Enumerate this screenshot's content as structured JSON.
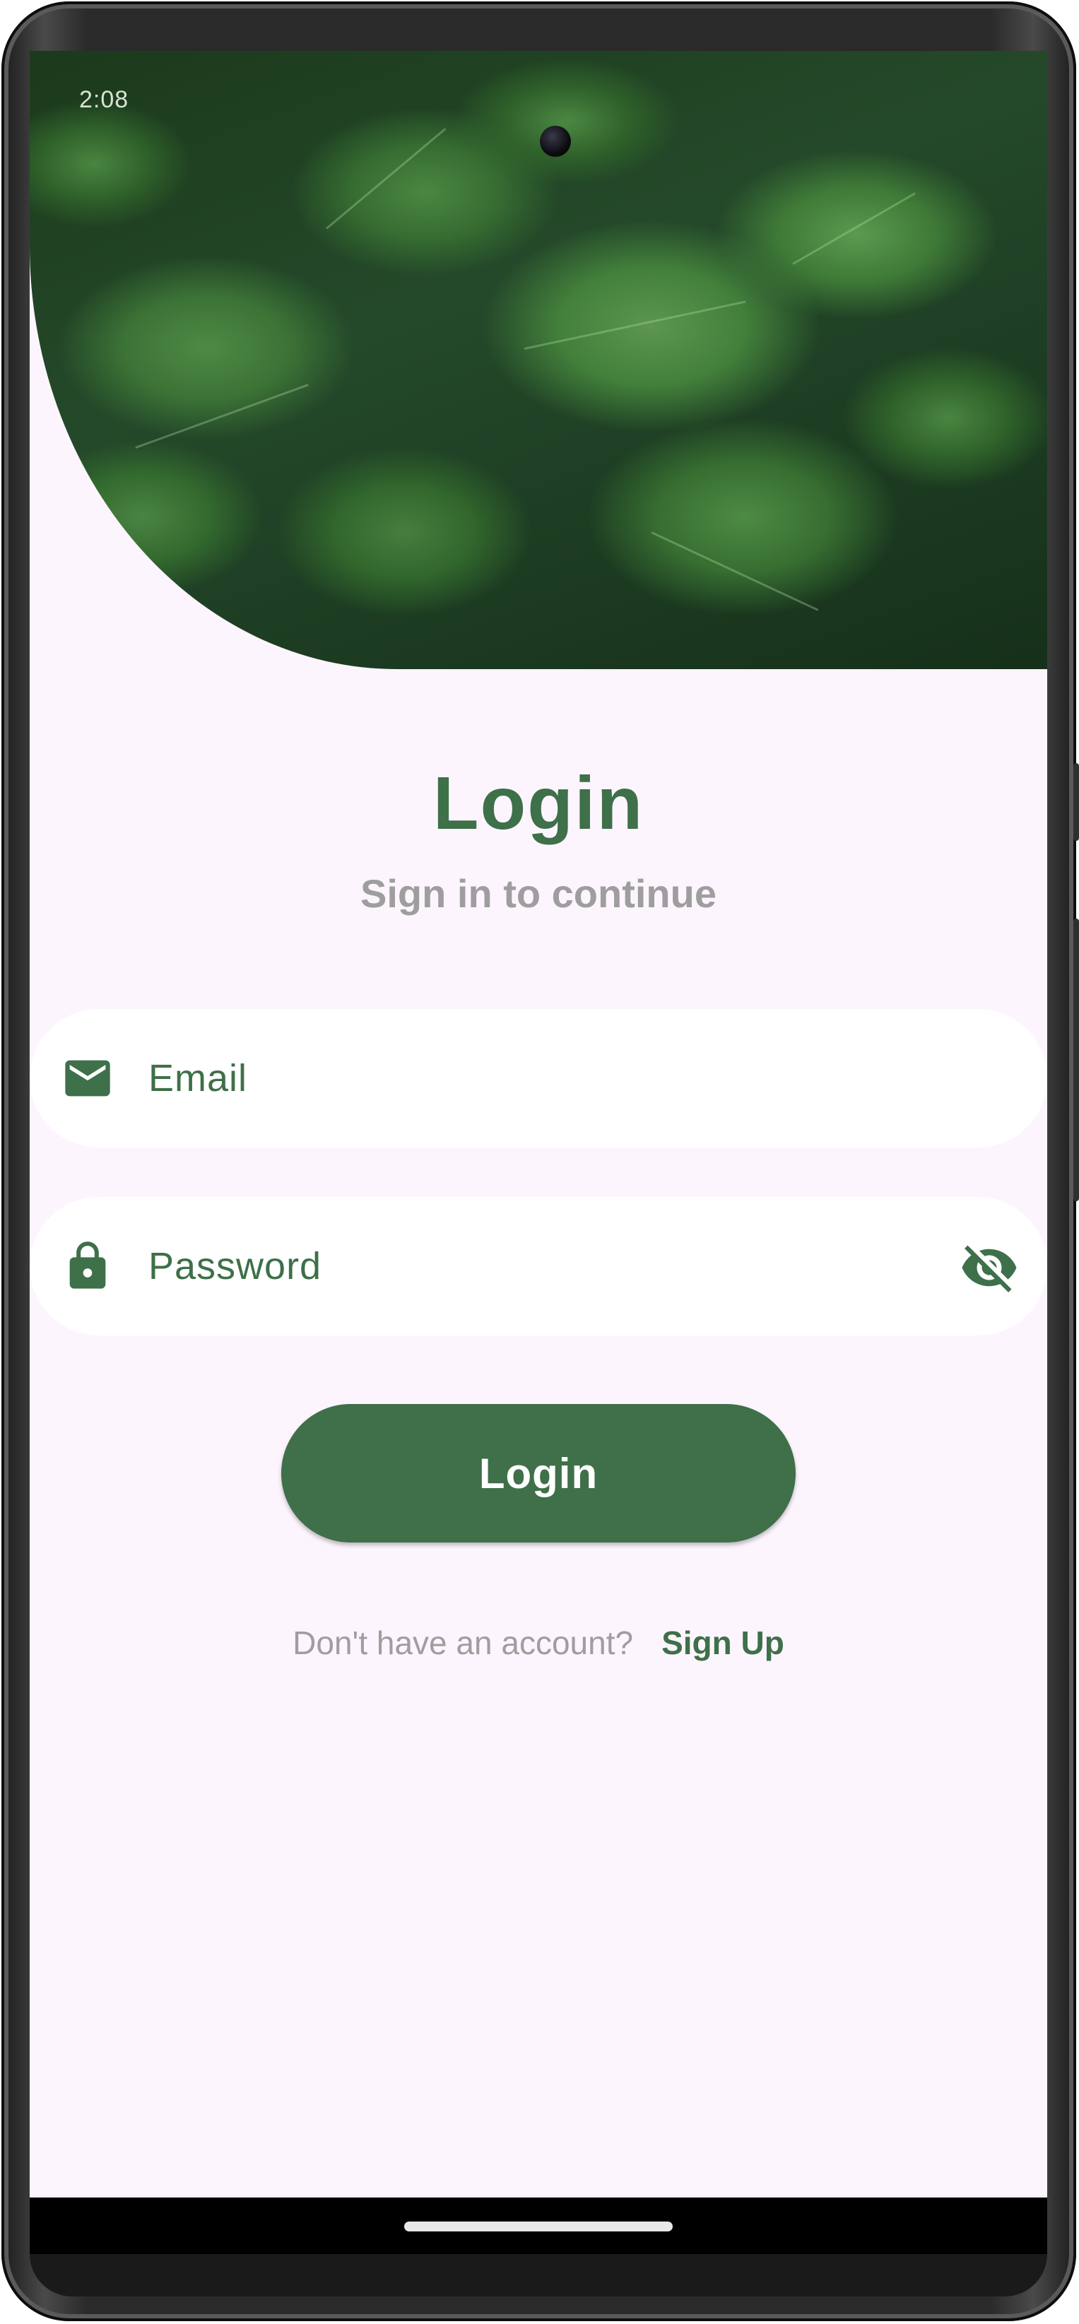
{
  "status_bar": {
    "time": "2:08"
  },
  "header": {
    "image_icon": "leaves-photo"
  },
  "login": {
    "title": "Login",
    "subtitle": "Sign in to continue"
  },
  "form": {
    "email": {
      "label": "Email",
      "icon": "mail-icon"
    },
    "password": {
      "label": "Password",
      "icon": "lock-icon",
      "toggle_icon": "eye-off-icon"
    }
  },
  "actions": {
    "login_button": "Login",
    "signup_prompt": "Don't have an account?",
    "signup_link": "Sign Up"
  },
  "colors": {
    "accent": "#3f7049",
    "background": "#fdf5fd",
    "muted_text": "#9e9e9e"
  }
}
